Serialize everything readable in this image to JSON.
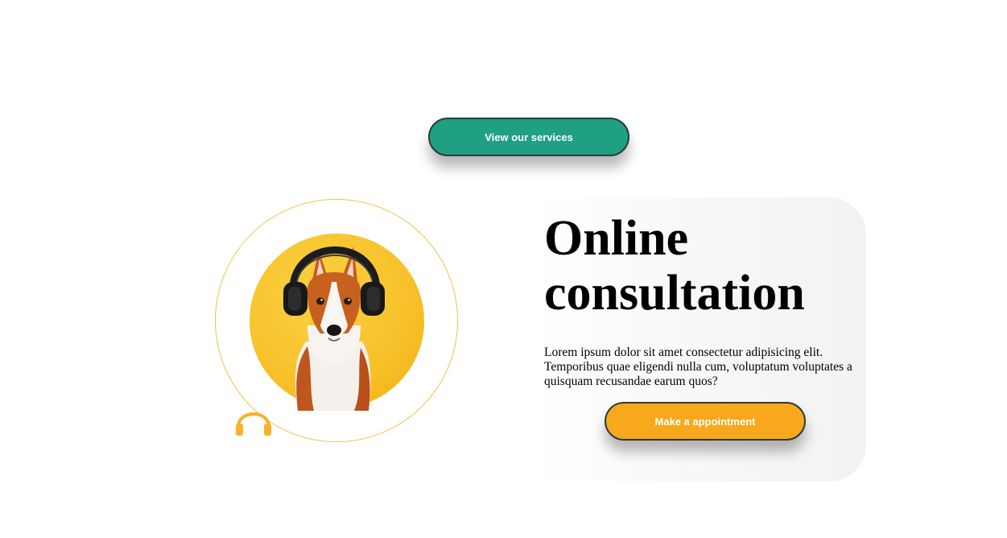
{
  "services_button": {
    "label": "View our services",
    "color": "#20a083"
  },
  "hero": {
    "title": "Online consultation",
    "description": "Lorem ipsum dolor sit amet consectetur adipisicing elit. Temporibus quae eligendi nulla cum, voluptatum voluptates a quisquam recusandae earum quos?",
    "cta_label": "Make a appointment",
    "cta_color": "#f7a81c"
  },
  "illustration": {
    "image": "dog-with-headphones",
    "badge_icon": "headphones-icon",
    "accent": "#f8c22c"
  }
}
